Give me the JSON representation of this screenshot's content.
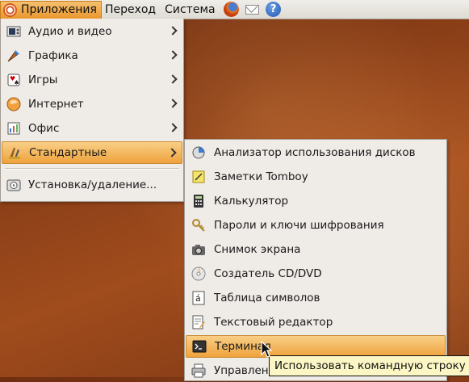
{
  "panel": {
    "menus": [
      {
        "label": "Приложения",
        "active": true
      },
      {
        "label": "Переход",
        "active": false
      },
      {
        "label": "Система",
        "active": false
      }
    ],
    "launchers": [
      "firefox-icon",
      "mail-icon",
      "help-icon"
    ],
    "help_glyph": "?"
  },
  "applications_menu": {
    "items": [
      {
        "label": "Аудио и видео",
        "icon": "audio-video-icon",
        "submenu": true
      },
      {
        "label": "Графика",
        "icon": "graphics-icon",
        "submenu": true
      },
      {
        "label": "Игры",
        "icon": "games-icon",
        "submenu": true
      },
      {
        "label": "Интернет",
        "icon": "internet-icon",
        "submenu": true
      },
      {
        "label": "Офис",
        "icon": "office-icon",
        "submenu": true
      },
      {
        "label": "Стандартные",
        "icon": "accessories-icon",
        "submenu": true,
        "highlighted": true
      },
      {
        "label": "Установка/удаление...",
        "icon": "add-remove-icon",
        "submenu": false
      }
    ]
  },
  "accessories_submenu": {
    "items": [
      {
        "label": "Анализатор использования дисков",
        "icon": "disk-usage-icon"
      },
      {
        "label": "Заметки Tomboy",
        "icon": "notes-icon"
      },
      {
        "label": "Калькулятор",
        "icon": "calculator-icon"
      },
      {
        "label": "Пароли и ключи шифрования",
        "icon": "keys-icon"
      },
      {
        "label": "Снимок экрана",
        "icon": "screenshot-icon"
      },
      {
        "label": "Создатель CD/DVD",
        "icon": "cd-burner-icon"
      },
      {
        "label": "Таблица символов",
        "icon": "character-map-icon"
      },
      {
        "label": "Текстовый редактор",
        "icon": "text-editor-icon"
      },
      {
        "label": "Терминал",
        "icon": "terminal-icon",
        "highlighted": true
      },
      {
        "label": "Управление заданиями печати",
        "icon": "print-jobs-icon"
      }
    ]
  },
  "tooltip": {
    "text": "Использовать командную строку"
  },
  "colors": {
    "highlight": "#efa23d",
    "menu_bg": "#efebe7",
    "ubuntu_orange": "#d8581c"
  }
}
